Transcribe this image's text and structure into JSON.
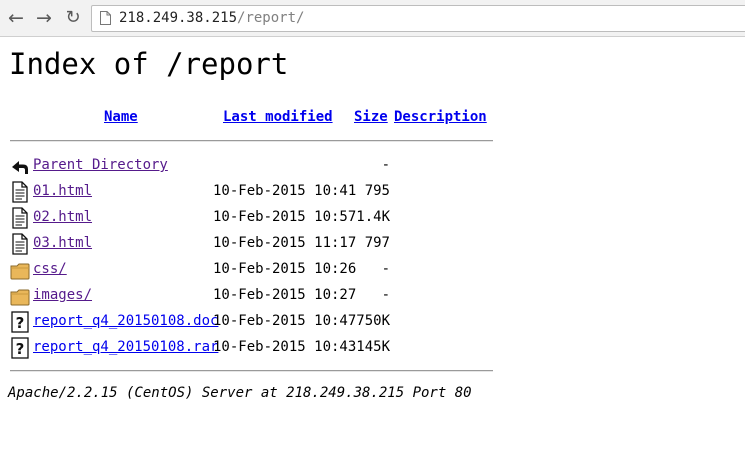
{
  "browser": {
    "url_host": "218.249.38.215",
    "url_path": "/report/"
  },
  "page": {
    "title": "Index of /report"
  },
  "table": {
    "headers": {
      "name": "Name",
      "last_modified": "Last modified",
      "size": "Size",
      "description": "Description"
    },
    "rows": [
      {
        "name": "Parent Directory",
        "modified": "",
        "size": "-",
        "icon": "back-arrow-icon"
      },
      {
        "name": "01.html",
        "modified": "10-Feb-2015 10:41",
        "size": "795",
        "icon": "text-file-icon"
      },
      {
        "name": "02.html",
        "modified": "10-Feb-2015 10:57",
        "size": "1.4K",
        "icon": "text-file-icon"
      },
      {
        "name": "03.html",
        "modified": "10-Feb-2015 11:17",
        "size": "797",
        "icon": "text-file-icon"
      },
      {
        "name": "css/",
        "modified": "10-Feb-2015 10:26",
        "size": "-",
        "icon": "folder-icon"
      },
      {
        "name": "images/",
        "modified": "10-Feb-2015 10:27",
        "size": "-",
        "icon": "folder-icon"
      },
      {
        "name": "report_q4_20150108.doc",
        "modified": "10-Feb-2015 10:47",
        "size": "750K",
        "icon": "unknown-file-icon"
      },
      {
        "name": "report_q4_20150108.rar",
        "modified": "10-Feb-2015 10:43",
        "size": "145K",
        "icon": "unknown-file-icon"
      }
    ]
  },
  "footer": {
    "server_signature": "Apache/2.2.15 (CentOS) Server at 218.249.38.215 Port 80"
  }
}
